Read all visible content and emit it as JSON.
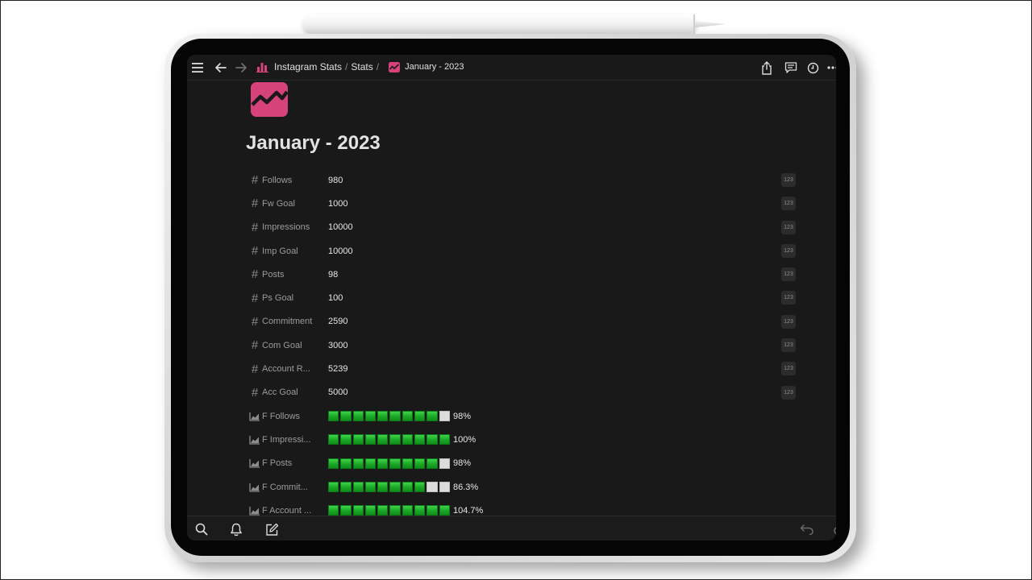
{
  "breadcrumb": {
    "workspace": "Instagram Stats",
    "parent": "Stats",
    "current": "January - 2023"
  },
  "page": {
    "title": "January - 2023"
  },
  "number_properties": [
    {
      "name": "Follows",
      "value": "980",
      "type_badge": "123"
    },
    {
      "name": "Fw Goal",
      "value": "1000",
      "type_badge": "123"
    },
    {
      "name": "Impressions",
      "value": "10000",
      "type_badge": "123"
    },
    {
      "name": "Imp Goal",
      "value": "10000",
      "type_badge": "123"
    },
    {
      "name": "Posts",
      "value": "98",
      "type_badge": "123"
    },
    {
      "name": "Ps Goal",
      "value": "100",
      "type_badge": "123"
    },
    {
      "name": "Commitment",
      "value": "2590",
      "type_badge": "123"
    },
    {
      "name": "Com Goal",
      "value": "3000",
      "type_badge": "123"
    },
    {
      "name": "Account R...",
      "value": "5239",
      "type_badge": "123"
    },
    {
      "name": "Acc Goal",
      "value": "5000",
      "type_badge": "123"
    }
  ],
  "formula_properties": [
    {
      "name": "F Follows",
      "filled": 9,
      "total": 10,
      "label": "98%"
    },
    {
      "name": "F Impressi...",
      "filled": 10,
      "total": 10,
      "label": "100%"
    },
    {
      "name": "F Posts",
      "filled": 9,
      "total": 10,
      "label": "98%"
    },
    {
      "name": "F Commit...",
      "filled": 8,
      "total": 10,
      "label": "86.3%"
    },
    {
      "name": "F Account ...",
      "filled": 10,
      "total": 10,
      "label": "104.7%"
    }
  ],
  "colors": {
    "accent": "#d6427a",
    "bar_on": "#1aa724",
    "bar_off": "#dcdcdc",
    "background": "#191919"
  },
  "icons": {
    "menu": "menu-icon",
    "back": "back-arrow-icon",
    "forward": "forward-arrow-icon",
    "share": "share-icon",
    "comments": "comment-icon",
    "history": "clock-icon",
    "more": "more-icon",
    "search": "search-icon",
    "notifications": "bell-icon",
    "new_page": "compose-icon",
    "undo": "undo-icon",
    "redo": "redo-icon"
  }
}
